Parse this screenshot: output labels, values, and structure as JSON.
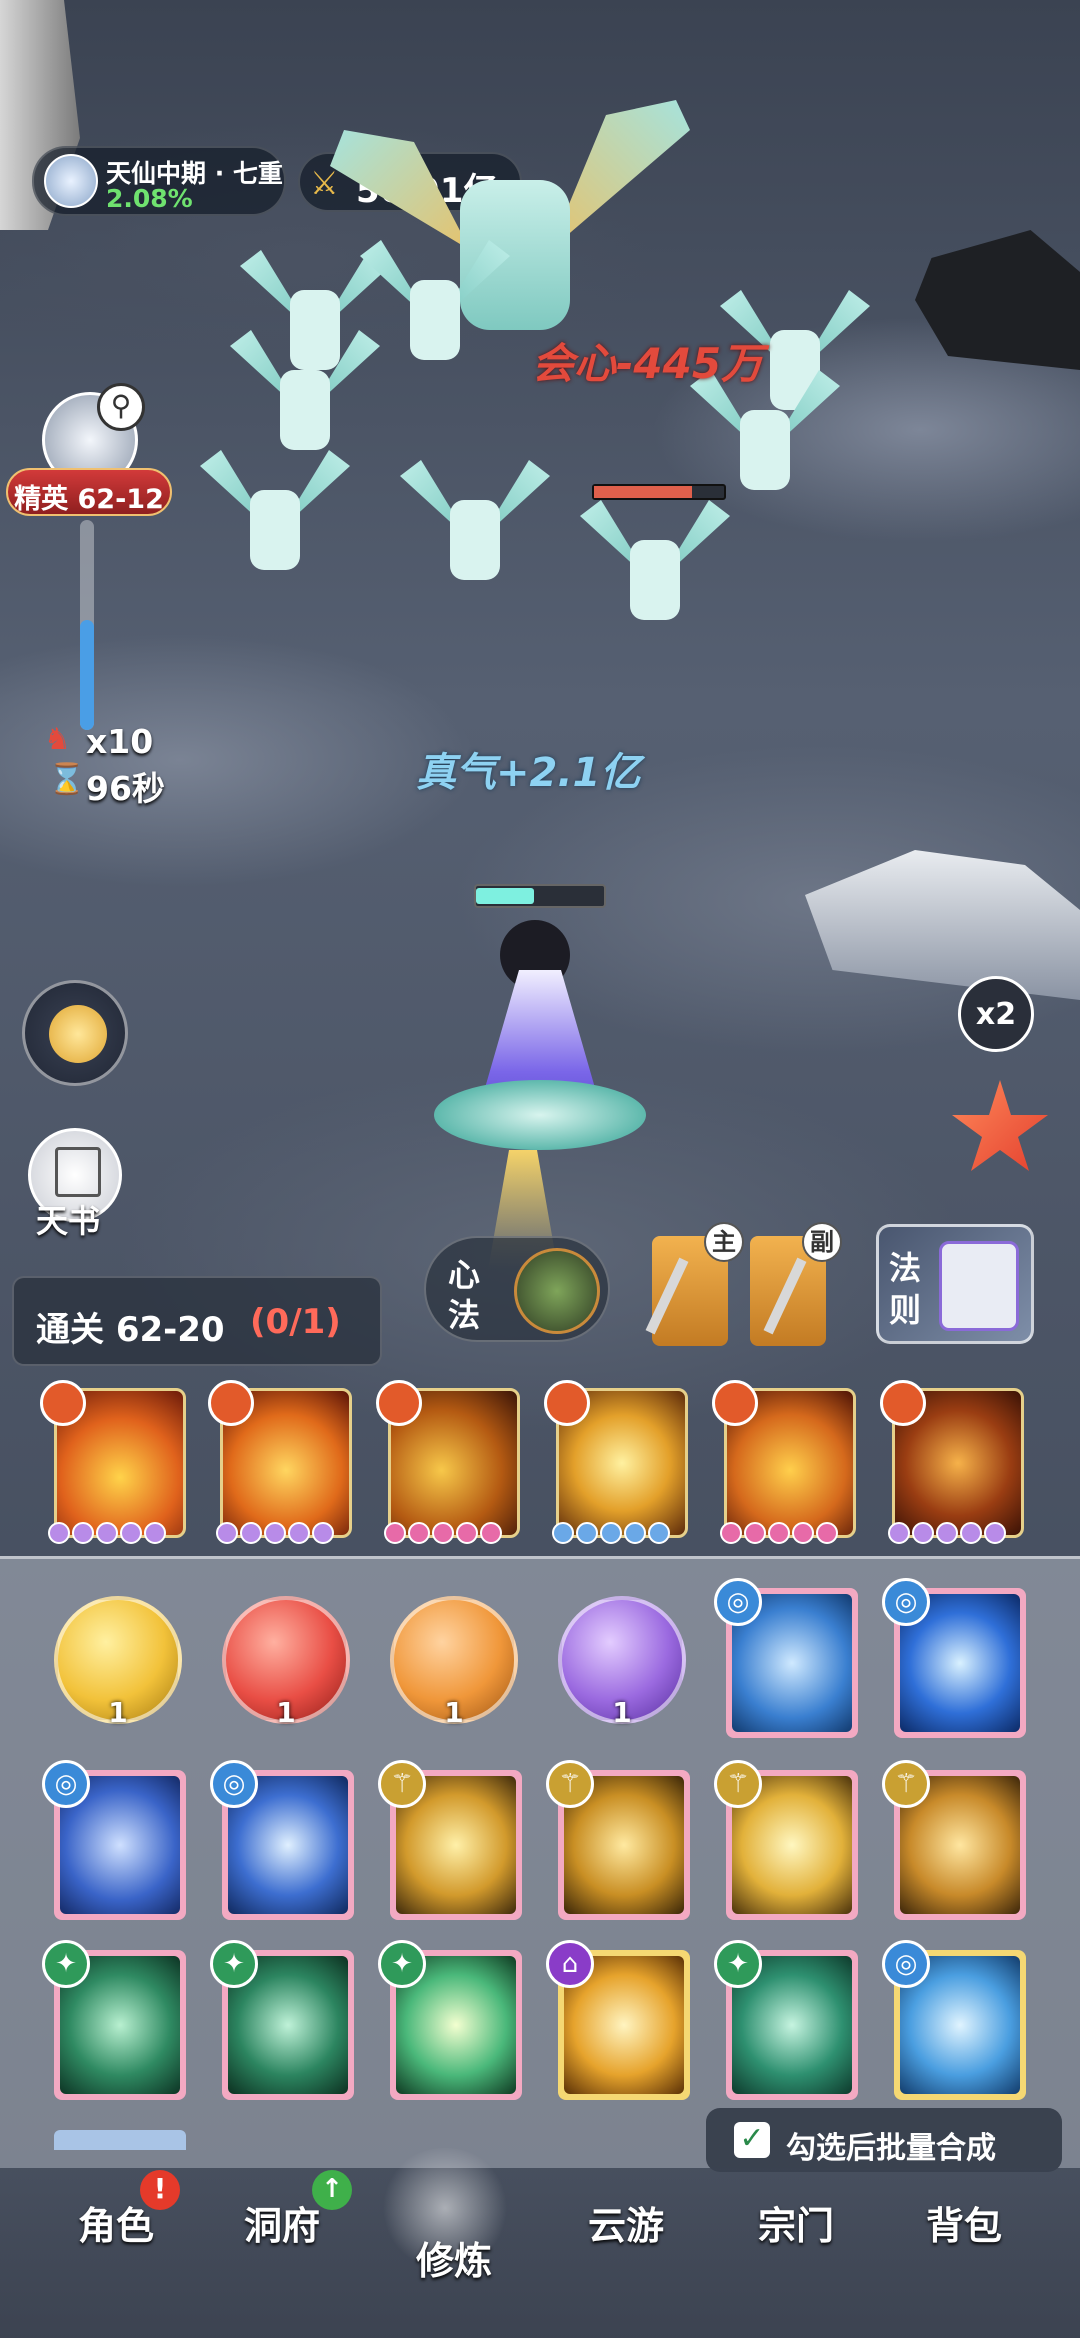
{
  "player": {
    "realm": "天仙中期 · 七重",
    "progress_percent": "2.08%",
    "combat_power": "56.91亿"
  },
  "stage": {
    "elite_label": "精英 62-12",
    "enemy_count": "x10",
    "timer": "96秒",
    "clear_label": "通关 62-20",
    "clear_progress": "(0/1)",
    "boss_hp_fraction": 0.75,
    "player_hp_fraction": 0.45
  },
  "combat_text": {
    "crit_damage": "会心-445万",
    "qi_gain": "真气+2.1亿"
  },
  "side_buttons": {
    "tianshu": "天书",
    "speed": "x2",
    "xinfa_1": "心",
    "xinfa_2": "法",
    "fa_1": "法",
    "fa_2": "则",
    "weapon_main": "主",
    "weapon_sub": "副"
  },
  "orbs": [
    {
      "count": "1",
      "color": "#f2c23a"
    },
    {
      "count": "1",
      "color": "#e94e45"
    },
    {
      "count": "1",
      "color": "#f0973a"
    },
    {
      "count": "1",
      "color": "#9b6ae0"
    }
  ],
  "batch": {
    "checkbox_checked": true,
    "label": "勾选后批量合成"
  },
  "nav": {
    "items": [
      "角色",
      "洞府",
      "修炼",
      "云游",
      "宗门",
      "背包"
    ],
    "active": "修炼"
  },
  "colors": {
    "accent_gold": "#e6b84a",
    "crit_red": "#e34a3c",
    "qi_blue": "#8ed2f2",
    "elite_red": "#b52a2a"
  }
}
